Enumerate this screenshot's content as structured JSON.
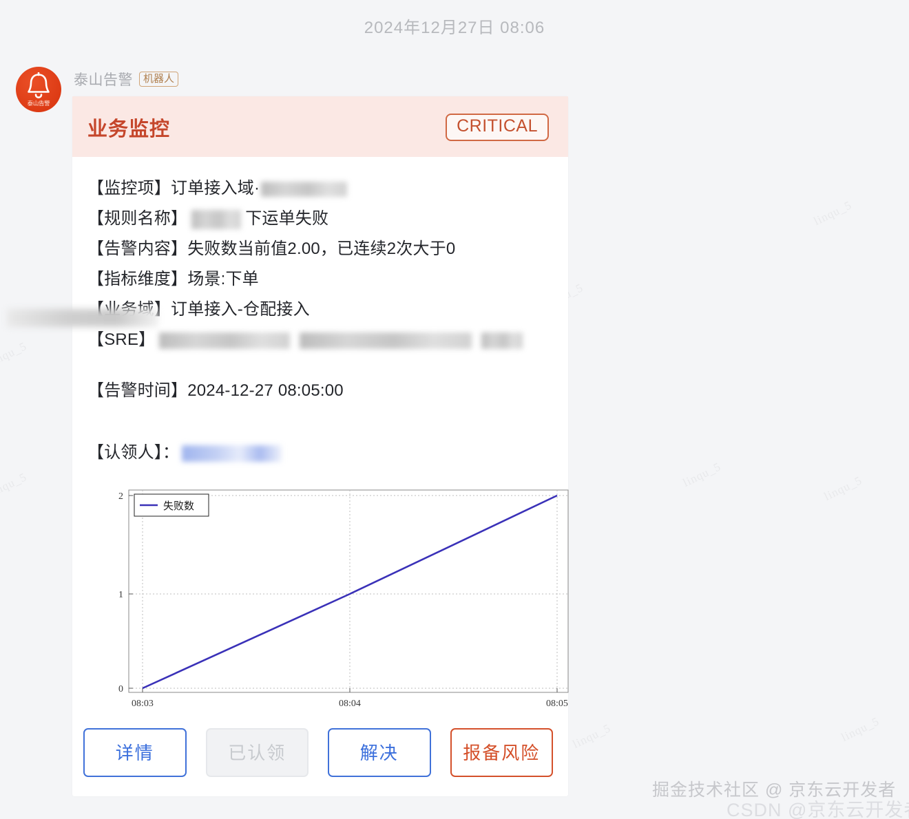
{
  "conversation": {
    "timestamp": "2024年12月27日 08:06",
    "sender_name": "泰山告警",
    "sender_badge": "机器人",
    "avatar_label": "泰山告警",
    "avatar_icon": "bell-icon"
  },
  "card": {
    "title": "业务监控",
    "severity": "CRITICAL",
    "fields": [
      {
        "label": "【监控项】",
        "value": "订单接入域·",
        "redacted": true
      },
      {
        "label": "【规则名称】",
        "value": "下运单失败",
        "redacted": true
      },
      {
        "label": "【告警内容】",
        "value": "失败数当前值2.00，已连续2次大于0",
        "redacted": false
      },
      {
        "label": "【指标维度】",
        "value": "场景:下单",
        "redacted": false
      },
      {
        "label": "【业务域】",
        "value": "订单接入-仓配接入",
        "redacted": false
      },
      {
        "label": "【SRE】",
        "value": "",
        "redacted": true
      },
      {
        "label": "【告警时间】",
        "value": "2024-12-27 08:05:00",
        "redacted": false
      },
      {
        "label": "【认领人】：",
        "value": "",
        "redacted": true
      }
    ],
    "buttons": [
      {
        "label": "详情",
        "state": "enabled",
        "style": "primary-outline"
      },
      {
        "label": "已认领",
        "state": "disabled",
        "style": "disabled"
      },
      {
        "label": "解决",
        "state": "enabled",
        "style": "primary-outline"
      },
      {
        "label": "报备风险",
        "state": "enabled",
        "style": "danger-outline"
      }
    ]
  },
  "chart_data": {
    "type": "line",
    "title": "",
    "xlabel": "",
    "ylabel": "",
    "legend": [
      "失败数"
    ],
    "legend_position": "top-left",
    "grid": true,
    "line_color": "#3a31b8",
    "x": [
      "08:03",
      "08:04",
      "08:05"
    ],
    "xticklabels": [
      "08:03",
      "08:04",
      "08:05"
    ],
    "yticklabels": [
      "0",
      "1",
      "2"
    ],
    "ylim": [
      0,
      2
    ],
    "series": [
      {
        "name": "失败数",
        "values": [
          0,
          1,
          2
        ]
      }
    ]
  },
  "watermarks": {
    "juejin": "掘金技术社区 @ 京东云开发者",
    "csdn": "CSDN @京东云开发者",
    "tile_text": "linqu_5"
  },
  "colors": {
    "severity": "#c4512f",
    "header_bg": "#fbe8e4",
    "title": "#c5462b",
    "accent_blue": "#3b6fdc",
    "accent_red": "#d4502a",
    "chart_line": "#3a31b8"
  }
}
